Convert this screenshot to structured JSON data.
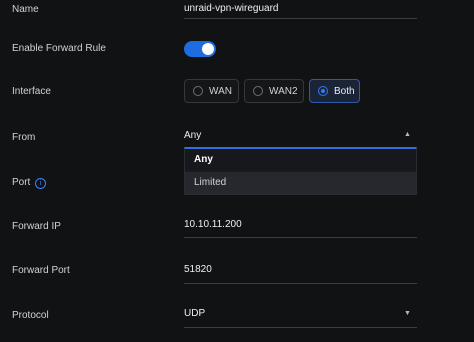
{
  "fields": {
    "name": {
      "label": "Name",
      "value": "unraid-vpn-wireguard"
    },
    "forward_rule": {
      "label": "Enable Forward Rule",
      "enabled": true
    },
    "interface": {
      "label": "Interface",
      "options": [
        "WAN",
        "WAN2",
        "Both"
      ],
      "selected": "Both"
    },
    "from": {
      "label": "From",
      "value": "Any",
      "options": [
        "Any",
        "Limited"
      ]
    },
    "port": {
      "label": "Port",
      "info_icon": "info-icon"
    },
    "forward_ip": {
      "label": "Forward IP",
      "value": "10.10.11.200"
    },
    "forward_port": {
      "label": "Forward Port",
      "value": "51820"
    },
    "protocol": {
      "label": "Protocol",
      "value": "UDP"
    }
  },
  "icons": {
    "chevron_up": "▲",
    "chevron_down": "▼",
    "info": "i"
  },
  "colors": {
    "accent": "#1f6ce0",
    "background": "#111214"
  }
}
